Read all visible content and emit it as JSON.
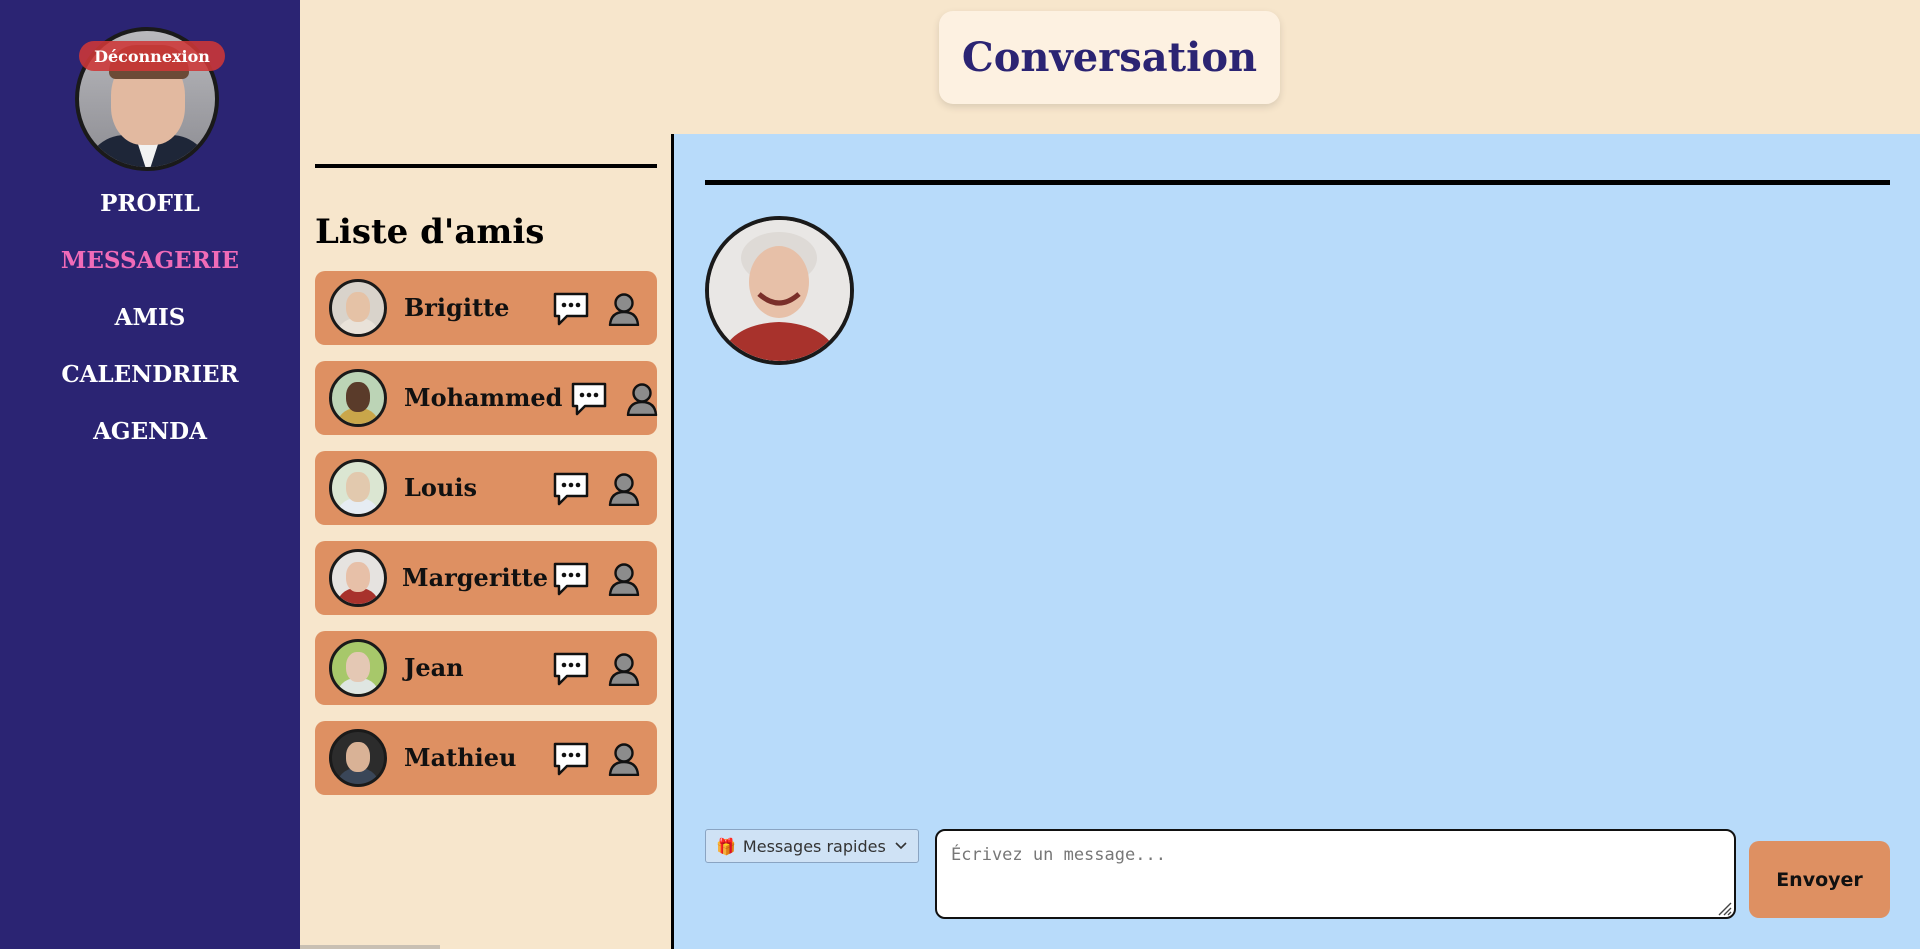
{
  "sidebar": {
    "logout_label": "Déconnexion",
    "nav": [
      {
        "label": "PROFIL",
        "active": false
      },
      {
        "label": "MESSAGERIE",
        "active": true
      },
      {
        "label": "AMIS",
        "active": false
      },
      {
        "label": "CALENDRIER",
        "active": false
      },
      {
        "label": "AGENDA",
        "active": false
      }
    ]
  },
  "header": {
    "title": "Conversation"
  },
  "friends": {
    "title": "Liste d'amis",
    "items": [
      {
        "name": "Brigitte",
        "message_icon": "speech-bubble-icon",
        "profile_icon": "person-icon"
      },
      {
        "name": "Mohammed",
        "message_icon": "speech-bubble-icon",
        "profile_icon": "person-icon"
      },
      {
        "name": "Louis",
        "message_icon": "speech-bubble-icon",
        "profile_icon": "person-icon"
      },
      {
        "name": "Margeritte",
        "message_icon": "speech-bubble-icon",
        "profile_icon": "person-icon"
      },
      {
        "name": "Jean",
        "message_icon": "speech-bubble-icon",
        "profile_icon": "person-icon"
      },
      {
        "name": "Mathieu",
        "message_icon": "speech-bubble-icon",
        "profile_icon": "person-icon"
      }
    ]
  },
  "chat": {
    "quick_messages_label": "Messages rapides",
    "quick_messages_icon": "gift-icon",
    "input_placeholder": "Écrivez un message...",
    "send_label": "Envoyer"
  },
  "colors": {
    "sidebar_bg": "#2b2473",
    "page_bg": "#f7e6cc",
    "chat_bg": "#b8dbfa",
    "friend_card": "#de9062",
    "active_nav": "#f06bb8",
    "title_text": "#2b2473"
  }
}
